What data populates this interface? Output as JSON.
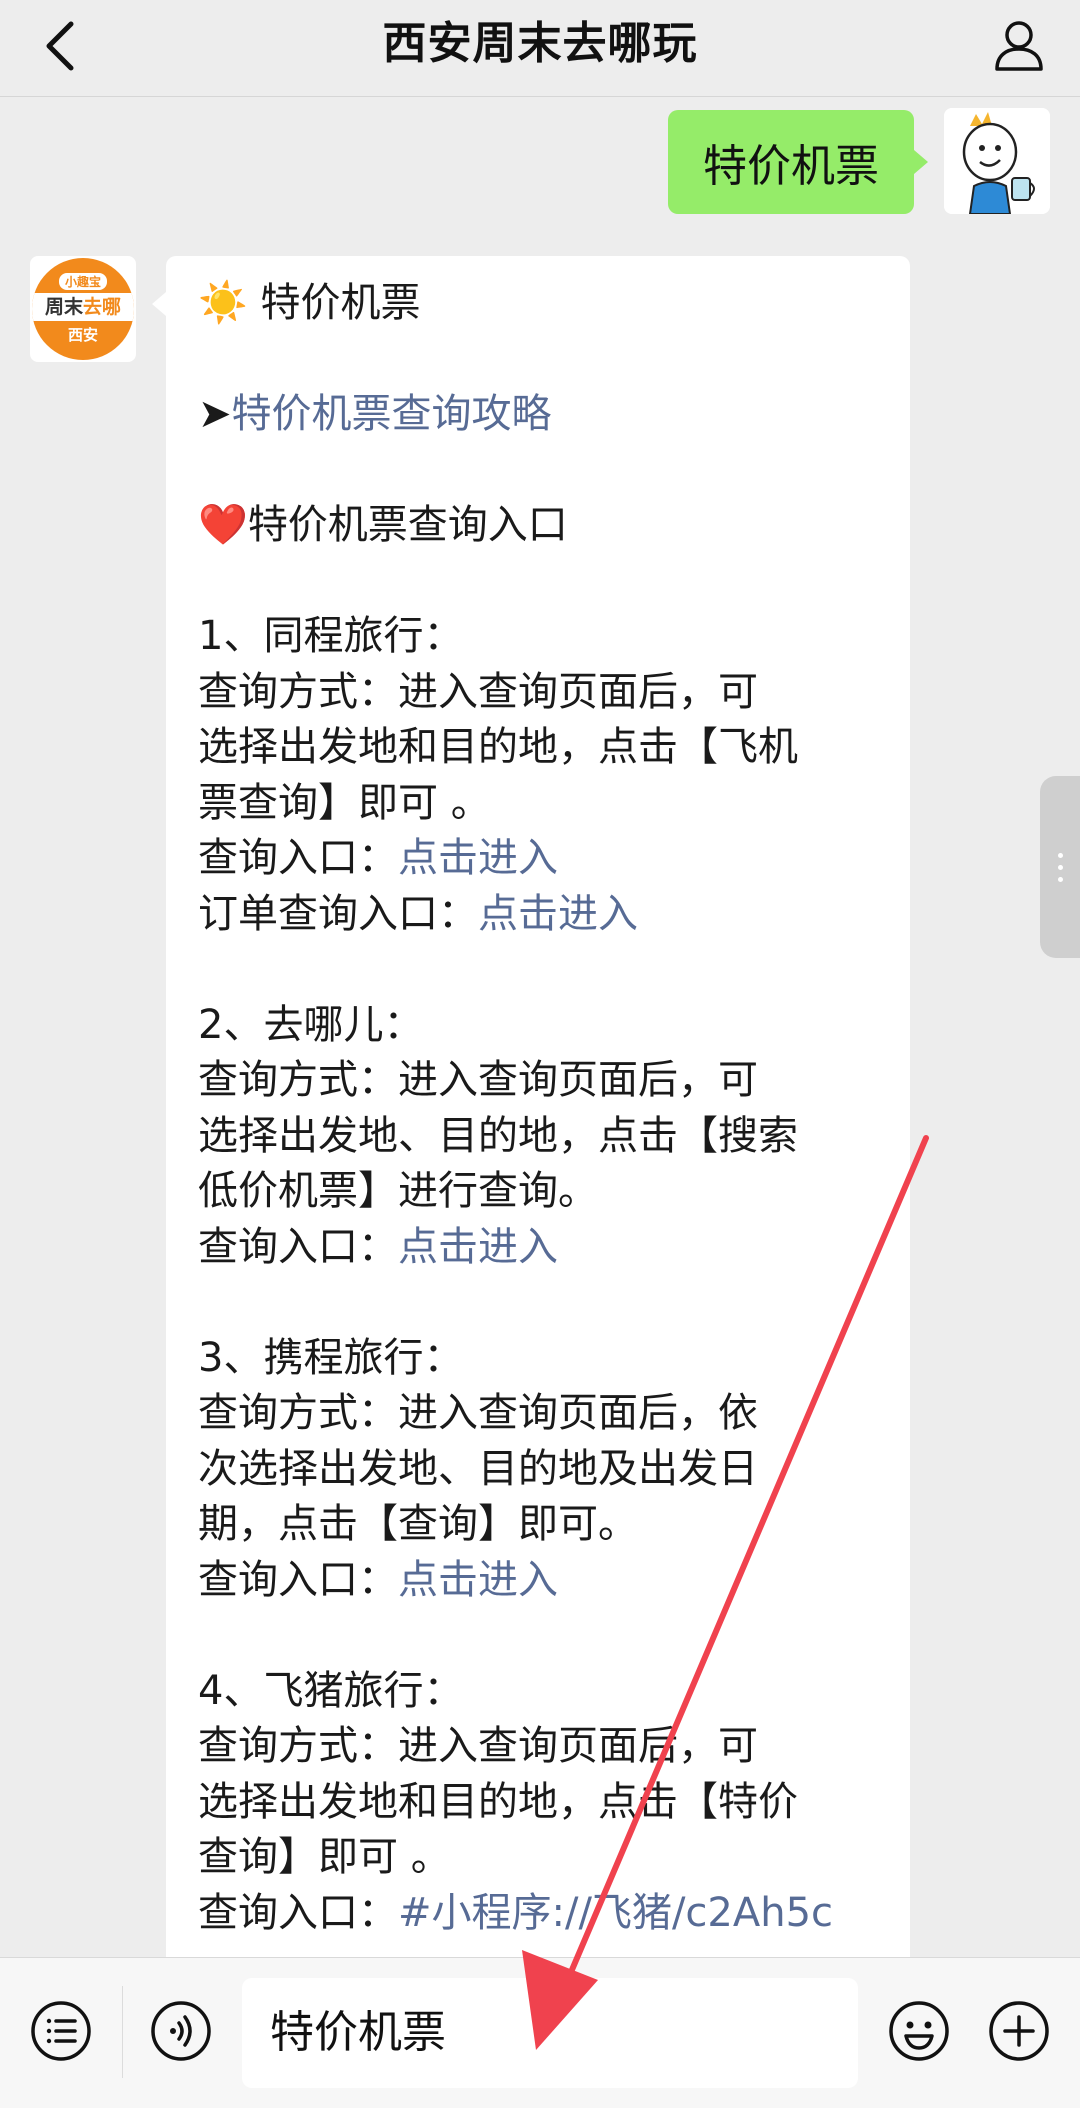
{
  "header": {
    "title": "西安周末去哪玩",
    "back_icon": "chevron-left-icon",
    "profile_icon": "person-icon"
  },
  "outgoing": {
    "text": "特价机票",
    "bubble_color": "#95ec69"
  },
  "official_avatar": {
    "top": "小趣宝",
    "mid_a": "周末",
    "mid_b": "去哪",
    "bottom": "西安",
    "color": "#f28a1c"
  },
  "message": {
    "title_emoji": "☀️",
    "title": "特价机票",
    "guide_prefix": "➤",
    "guide_link": "特价机票查询攻略",
    "entry_emoji": "❤️",
    "entry_title": "特价机票查询入口",
    "section1": {
      "heading": "1、同程旅行：",
      "desc1": "查询方式：进入查询页面后，可",
      "desc2": "选择出发地和目的地，点击【飞机",
      "desc3": "票查询】即可 。",
      "entry_label": "查询入口：",
      "entry_link": "点击进入",
      "order_label": "订单查询入口：",
      "order_link": "点击进入"
    },
    "section2": {
      "heading": "2、去哪儿：",
      "desc1": "查询方式：进入查询页面后，可",
      "desc2": "选择出发地、目的地，点击【搜索",
      "desc3": "低价机票】进行查询。",
      "entry_label": "查询入口：",
      "entry_link": "点击进入"
    },
    "section3": {
      "heading": "3、携程旅行：",
      "desc1": "查询方式：进入查询页面后，依",
      "desc2": "次选择出发地、目的地及出发日",
      "desc3": "期，点击【查询】即可。",
      "entry_label": "查询入口：",
      "entry_link": "点击进入"
    },
    "section4": {
      "heading": "4、飞猪旅行：",
      "desc1": "查询方式：进入查询页面后，可",
      "desc2": "选择出发地和目的地，点击【特价",
      "desc3": "查询】即可 。",
      "entry_label": "查询入口：",
      "entry_link": "#小程序://飞猪/c2Ah5c"
    },
    "link_color": "#576b95"
  },
  "bottom_bar": {
    "input_value": "特价机票",
    "menu_icon": "menu-list-icon",
    "voice_icon": "voice-icon",
    "emoji_icon": "emoji-icon",
    "plus_icon": "plus-icon"
  },
  "annotation": {
    "arrow_color": "#f0424e"
  }
}
